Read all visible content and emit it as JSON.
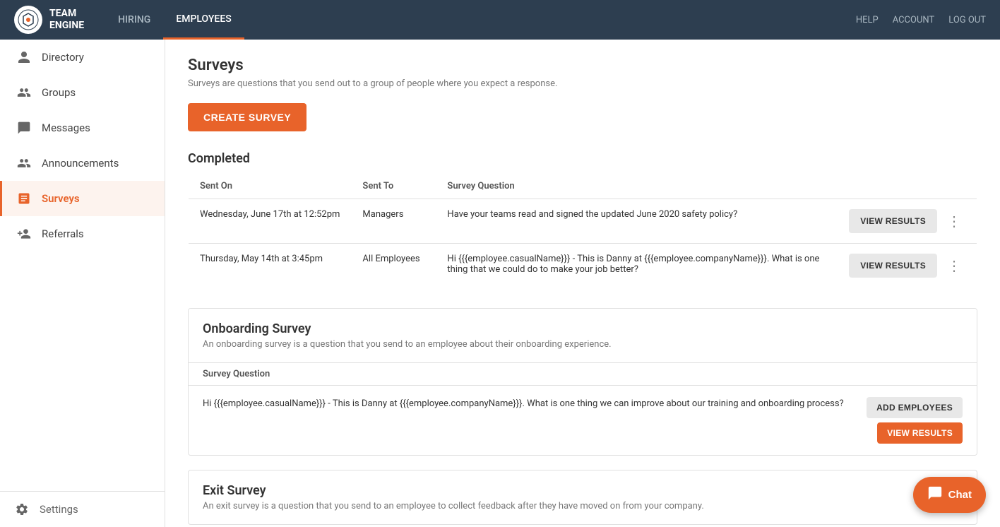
{
  "topNav": {
    "logo": {
      "icon": "TE",
      "text_line1": "TEAM",
      "text_line2": "ENGINE"
    },
    "links": [
      {
        "label": "HIRING",
        "active": false
      },
      {
        "label": "EMPLOYEES",
        "active": true
      }
    ],
    "right_links": [
      {
        "label": "HELP"
      },
      {
        "label": "ACCOUNT"
      },
      {
        "label": "LOG OUT"
      }
    ]
  },
  "sidebar": {
    "items": [
      {
        "label": "Directory",
        "icon": "person",
        "active": false
      },
      {
        "label": "Groups",
        "icon": "group",
        "active": false
      },
      {
        "label": "Messages",
        "icon": "chat_bubble",
        "active": false
      },
      {
        "label": "Announcements",
        "icon": "people",
        "active": false
      },
      {
        "label": "Surveys",
        "icon": "assignment",
        "active": true
      },
      {
        "label": "Referrals",
        "icon": "person_add",
        "active": false
      }
    ],
    "footer": {
      "label": "Settings",
      "icon": "settings"
    }
  },
  "main": {
    "surveys": {
      "title": "Surveys",
      "description": "Surveys are questions that you send out to a group of people where you expect a response.",
      "create_button": "CREATE SURVEY",
      "completed": {
        "section_title": "Completed",
        "columns": [
          "Sent On",
          "Sent To",
          "Survey Question"
        ],
        "rows": [
          {
            "sent_on": "Wednesday, June 17th at 12:52pm",
            "sent_to": "Managers",
            "question": "Have your teams read and signed the updated June 2020 safety policy?",
            "view_results": "VIEW RESULTS"
          },
          {
            "sent_on": "Thursday, May 14th at 3:45pm",
            "sent_to": "All Employees",
            "question": "Hi {{{employee.casualName}}} - This is Danny at {{{employee.companyName}}}. What is one thing that we could do to make your job better?",
            "view_results": "VIEW RESULTS"
          }
        ]
      },
      "onboarding": {
        "title": "Onboarding Survey",
        "description": "An onboarding survey is a question that you send to an employee about their onboarding experience.",
        "column_header": "Survey Question",
        "row_question": "Hi {{{employee.casualName}}} - This is Danny at {{{employee.companyName}}}. What is one thing we can improve about our training and onboarding process?",
        "add_employees_btn": "ADD EMPLOYEES",
        "view_results_btn": "VIEW RESULTS"
      },
      "exit": {
        "title": "Exit Survey",
        "description": "An exit survey is a question that you send to an employee to collect feedback after they have moved on from your company."
      }
    }
  },
  "chat": {
    "label": "Chat"
  }
}
